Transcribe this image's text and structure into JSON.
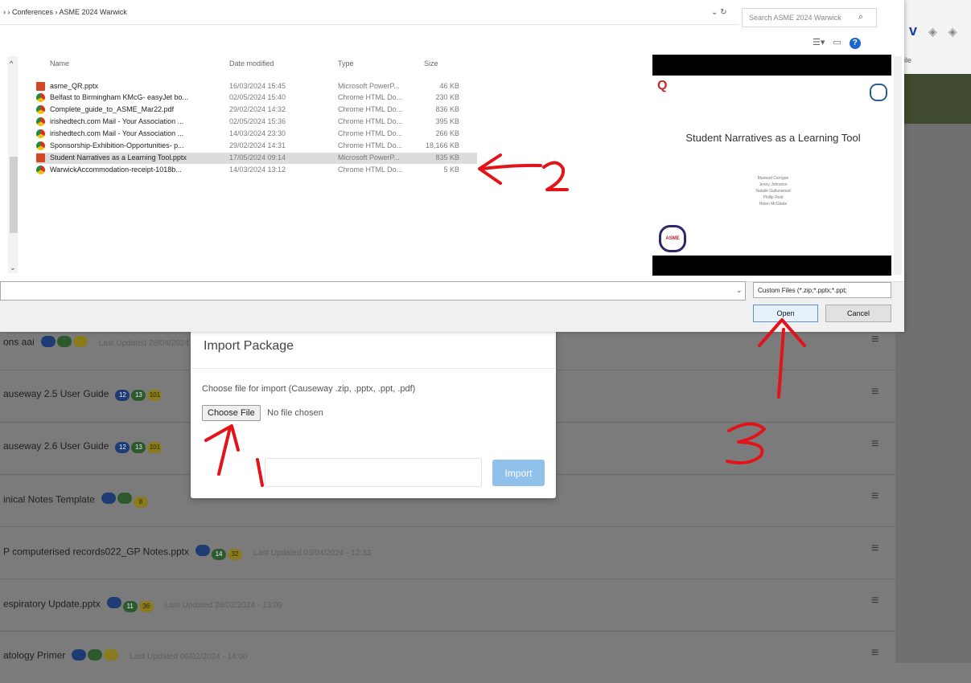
{
  "colors": {
    "annotation": "#e3131a",
    "accent": "#1b66c9",
    "import_button": "#8fc1ea"
  },
  "dialog": {
    "breadcrumb": "› › Conferences › ASME 2024 Warwick",
    "search_placeholder": "Search ASME 2024 Warwick",
    "columns": {
      "name": "Name",
      "date": "Date modified",
      "type": "Type",
      "size": "Size"
    },
    "files": [
      {
        "name": "asme_QR.pptx",
        "date": "16/03/2024 15:45",
        "type": "Microsoft PowerP...",
        "size": "46 KB",
        "icon": "ppt-icon"
      },
      {
        "name": "Belfast to Birmingham KMcG- easyJet bo...",
        "date": "02/05/2024 15:40",
        "type": "Chrome HTML Do...",
        "size": "230 KB",
        "icon": "chrome-icon"
      },
      {
        "name": "Complete_guide_to_ASME_Mar22.pdf",
        "date": "29/02/2024 14:32",
        "type": "Chrome HTML Do...",
        "size": "836 KB",
        "icon": "chrome-icon"
      },
      {
        "name": "irishedtech.com Mail - Your Association ...",
        "date": "02/05/2024 15:36",
        "type": "Chrome HTML Do...",
        "size": "395 KB",
        "icon": "chrome-icon"
      },
      {
        "name": "irishedtech.com Mail - Your Association ...",
        "date": "14/03/2024 23:30",
        "type": "Chrome HTML Do...",
        "size": "266 KB",
        "icon": "chrome-icon"
      },
      {
        "name": "Sponsorship-Exhibition-Opportunities- p...",
        "date": "29/02/2024 14:31",
        "type": "Chrome HTML Do...",
        "size": "18,166 KB",
        "icon": "chrome-icon"
      },
      {
        "name": "Student Narratives as a Learning Tool.pptx",
        "date": "17/05/2024 09:14",
        "type": "Microsoft PowerP...",
        "size": "835 KB",
        "icon": "ppt-icon"
      },
      {
        "name": "WarwickAccommodation-receipt-1018b...",
        "date": "14/03/2024 13:12",
        "type": "Chrome HTML Do...",
        "size": "5 KB",
        "icon": "chrome-icon"
      }
    ],
    "selected_index": 6,
    "preview": {
      "title": "Student Narratives as a Learning Tool",
      "authors": [
        "Mairead Corrigan",
        "Jenny Johnston",
        "Natalie Gallanwood",
        "Phillip Reid",
        "Helen McGlade"
      ],
      "asme_logo": "ASME"
    },
    "filter": "Custom Files (*.zip;*.pptx;*.ppt;",
    "open_label": "Open",
    "cancel_label": "Cancel"
  },
  "modal": {
    "title": "Import Package",
    "instruction": "Choose file for import (Causeway .zip, .pptx, .ppt, .pdf)",
    "choose_label": "Choose File",
    "no_file": "No file chosen",
    "import_label": "Import"
  },
  "background": {
    "rows": [
      {
        "title": "ons aai",
        "badges": [
          "",
          "",
          ""
        ],
        "updated": "Last Updated 28/04/2024"
      },
      {
        "title": "auseway 2.5 User Guide",
        "badges": [
          "12",
          "13",
          "101"
        ],
        "updated": ""
      },
      {
        "title": "auseway 2.6 User Guide",
        "badges": [
          "12",
          "13",
          "101"
        ],
        "updated": ""
      },
      {
        "title": "inical Notes Template",
        "badges": [
          "",
          "",
          "8"
        ],
        "updated": ""
      },
      {
        "title": "P computerised records022_GP Notes.pptx",
        "badges": [
          "",
          "14",
          "32"
        ],
        "updated": "Last Updated 03/04/2024 - 12:33"
      },
      {
        "title": "espiratory Update.pptx",
        "badges": [
          "",
          "11",
          "36"
        ],
        "updated": "Last Updated 28/02/2024 - 13:09"
      },
      {
        "title": "atology Primer",
        "badges": [
          "",
          "",
          ""
        ],
        "updated": "Last Updated 06/02/2024 - 14:00"
      }
    ],
    "browser_tiny": "ile"
  },
  "annotations": {
    "one": "1",
    "two": "2",
    "three": "3"
  }
}
